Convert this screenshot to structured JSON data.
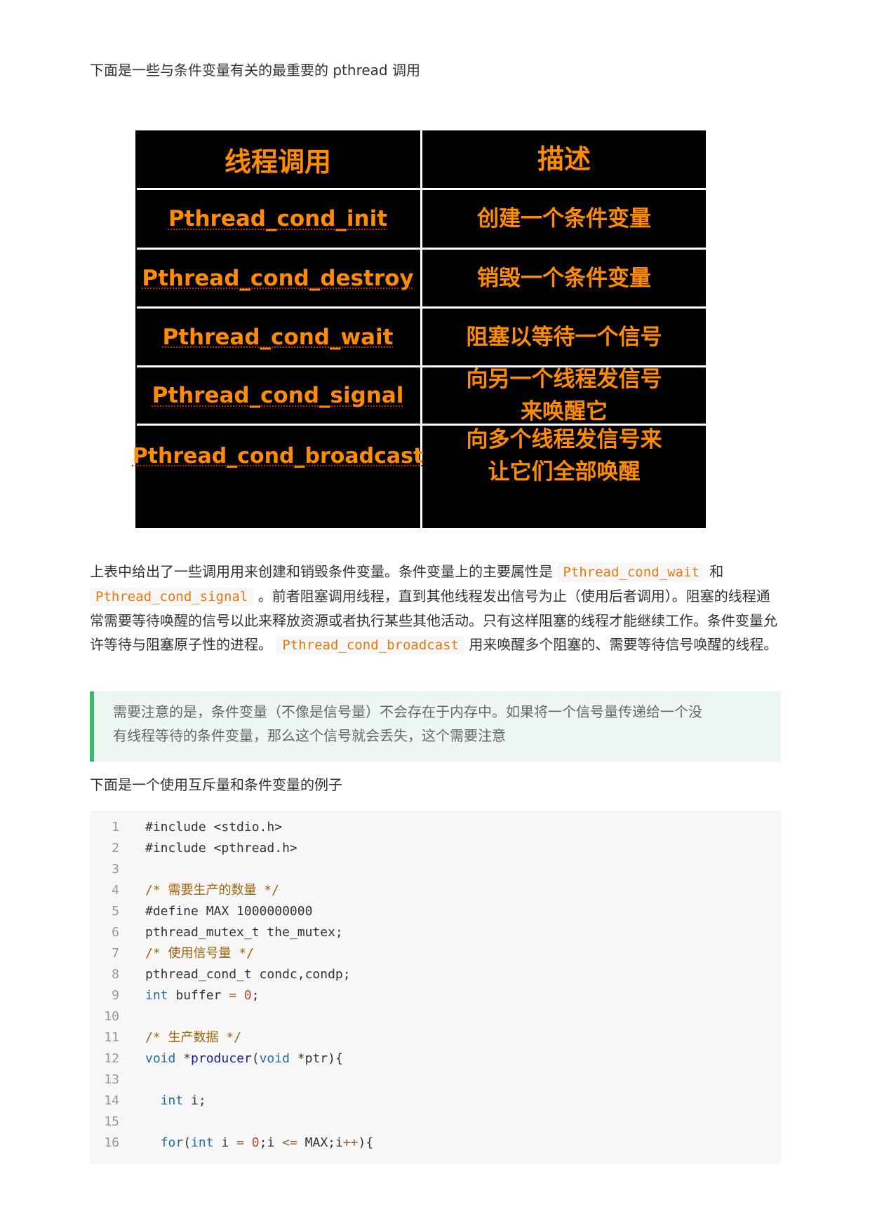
{
  "intro": "下面是一些与条件变量有关的最重要的 pthread 调用",
  "table": {
    "headers": [
      "线程调用",
      "描述"
    ],
    "rows": [
      {
        "call": "Pthread_cond_init",
        "desc_lines": [
          "创建一个条件变量"
        ]
      },
      {
        "call": "Pthread_cond_destroy",
        "desc_lines": [
          "销毁一个条件变量"
        ]
      },
      {
        "call": "Pthread_cond_wait",
        "desc_lines": [
          "阻塞以等待一个信号"
        ]
      },
      {
        "call": "Pthread_cond_signal",
        "desc_lines": [
          "向另一个线程发信号",
          "来唤醒它"
        ]
      },
      {
        "call": "Pthread_cond_broadcast",
        "desc_lines": [
          "向多个线程发信号来",
          "让它们全部唤醒"
        ]
      }
    ]
  },
  "paragraph": {
    "t1": "上表中给出了一些调用用来创建和销毁条件变量。条件变量上的主要属性是",
    "c1": "Pthread_cond_wait",
    "t2": "和",
    "c2": "Pthread_cond_signal",
    "t3": "。前者阻塞调用线程，直到其他线程发出信号为止（使用后者调用）。阻塞的线程通常需要等待唤醒的信号以此来释放资源或者执行某些其他活动。只有这样阻塞的线程才能继续工作。条件变量允许等待与阻塞原子性的进程。",
    "c3": "Pthread_cond_broadcast",
    "t4": "用来唤醒多个阻塞的、需要等待信号唤醒的线程。"
  },
  "note": {
    "line1": "需要注意的是，条件变量（不像是信号量）不会存在于内存中。如果将一个信号量传递给一个没",
    "line2": "有线程等待的条件变量，那么这个信号就会丢失，这个需要注意"
  },
  "example_intro": "下面是一个使用互斥量和条件变量的例子",
  "code": {
    "line_numbers": [
      "1",
      "2",
      "3",
      "4",
      "5",
      "6",
      "7",
      "8",
      "9",
      "10",
      "11",
      "12",
      "13",
      "14",
      "15",
      "16"
    ],
    "l1": "#include <stdio.h>",
    "l2": "#include <pthread.h>",
    "l4": "/* 需要生产的数量 */",
    "l5": "#define MAX 1000000000",
    "l6": "pthread_mutex_t the_mutex;",
    "l7": "/* 使用信号量 */",
    "l8": "pthread_cond_t condc,condp;",
    "l9_kw": "int",
    "l9_a": " buffer ",
    "l9_op": "=",
    "l9_sp": " ",
    "l9_num": "0",
    "l9_end": ";",
    "l11": "/* 生产数据 */",
    "l12_kw1": "void",
    "l12_a": " *",
    "l12_fn": "producer",
    "l12_b": "(",
    "l12_kw2": "void",
    "l12_c": " *ptr){",
    "l14_ind": "  ",
    "l14_kw": "int",
    "l14_a": " i;",
    "l16_ind": "  ",
    "l16_kw1": "for",
    "l16_a": "(",
    "l16_kw2": "int",
    "l16_b": " i ",
    "l16_op1": "=",
    "l16_sp": " ",
    "l16_num": "0",
    "l16_c": ";i ",
    "l16_op2": "<=",
    "l16_d": " MAX;i",
    "l16_op3": "++",
    "l16_e": "){"
  }
}
